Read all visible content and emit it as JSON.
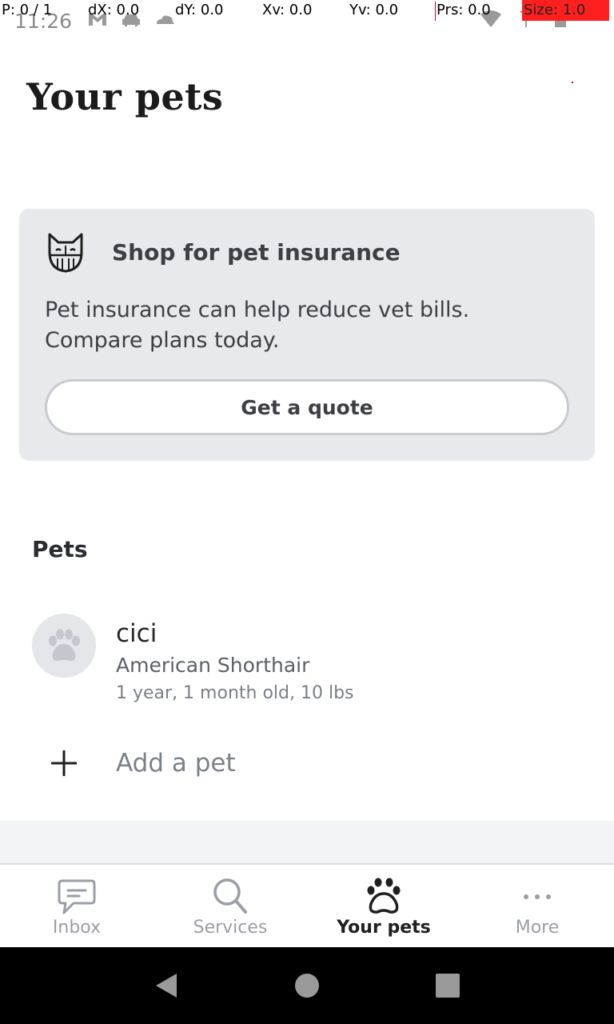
{
  "status_bar": {
    "time": "11:26",
    "icons_left": [
      "gmail-icon",
      "car-icon",
      "cloud-icon"
    ],
    "icons_right": [
      "wifi-icon",
      "signal-icon",
      "battery-icon"
    ]
  },
  "debug_overlay": {
    "p": "P: 0 / 1",
    "dx": "dX: 0.0",
    "dy": "dY: 0.0",
    "xv": "Xv: 0.0",
    "yv": "Yv: 0.0",
    "prs": "Prs: 0.0",
    "size": "Size: 1.0"
  },
  "header": {
    "title": "Your pets"
  },
  "insurance_card": {
    "icon": "cat-face-icon",
    "title": "Shop for pet insurance",
    "body_line1": "Pet insurance can help reduce vet bills.",
    "body_line2": "Compare plans today.",
    "button_label": "Get a quote"
  },
  "pets_section": {
    "title": "Pets",
    "pets": [
      {
        "name": "cici",
        "breed": "American Shorthair",
        "details": "1 year, 1 month old, 10 lbs",
        "avatar_icon": "paw-icon"
      }
    ],
    "add_label": "Add a pet"
  },
  "bottom_nav": {
    "items": [
      {
        "label": "Inbox",
        "icon": "chat-bubble-icon",
        "active": false
      },
      {
        "label": "Services",
        "icon": "search-icon",
        "active": false
      },
      {
        "label": "Your pets",
        "icon": "paw-icon",
        "active": true
      },
      {
        "label": "More",
        "icon": "more-dots-icon",
        "active": false
      }
    ]
  },
  "system_nav": {
    "buttons": [
      "back-icon",
      "home-icon",
      "recents-icon"
    ]
  },
  "colors": {
    "card_bg": "#e8e9ec",
    "text_dark": "#1f1f1f",
    "text_muted": "#7b8089",
    "nav_inactive": "#9a9ea6",
    "debug_red": "#ff1f1f"
  }
}
